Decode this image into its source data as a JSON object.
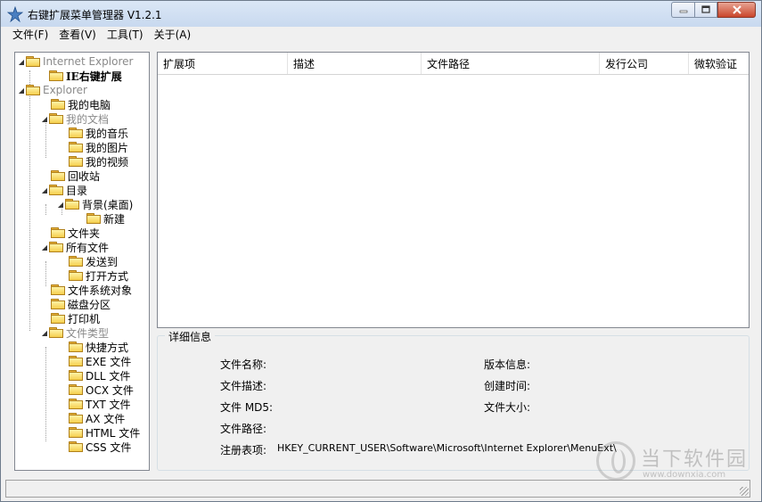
{
  "window": {
    "title": "右键扩展菜单管理器 V1.2.1",
    "controls": {
      "minimize": "minimize",
      "maximize": "maximize",
      "close": "close"
    }
  },
  "menubar": {
    "items": [
      "文件(F)",
      "查看(V)",
      "工具(T)",
      "关于(A)"
    ]
  },
  "tree": {
    "ie_root": "Internet Explorer",
    "ie_child": "IE右键扩展",
    "explorer_root": "Explorer",
    "my_computer": "我的电脑",
    "my_documents": "我的文档",
    "my_music": "我的音乐",
    "my_pictures": "我的图片",
    "my_videos": "我的视频",
    "recycle_bin": "回收站",
    "directory": "目录",
    "background": "背景(桌面)",
    "new": "新建",
    "folder": "文件夹",
    "all_files": "所有文件",
    "send_to": "发送到",
    "open_with": "打开方式",
    "fs_object": "文件系统对象",
    "drive": "磁盘分区",
    "printer": "打印机",
    "file_types": "文件类型",
    "ft_shortcut": "快捷方式",
    "ft_exe": "EXE 文件",
    "ft_dll": "DLL 文件",
    "ft_ocx": "OCX 文件",
    "ft_txt": "TXT 文件",
    "ft_ax": "AX 文件",
    "ft_html": "HTML 文件",
    "ft_css": "CSS 文件"
  },
  "list": {
    "columns": [
      "扩展项",
      "描述",
      "文件路径",
      "发行公司",
      "微软验证"
    ]
  },
  "details": {
    "legend": "详细信息",
    "file_name_label": "文件名称:",
    "file_desc_label": "文件描述:",
    "file_md5_label": "文件 MD5:",
    "file_path_label": "文件路径:",
    "registry_label": "注册表项:",
    "registry_value": "HKEY_CURRENT_USER\\Software\\Microsoft\\Internet Explorer\\MenuExt\\",
    "version_label": "版本信息:",
    "created_label": "创建时间:",
    "size_label": "文件大小:"
  },
  "watermark": {
    "brand": "当下软件园",
    "url": "www.downxia.com"
  }
}
